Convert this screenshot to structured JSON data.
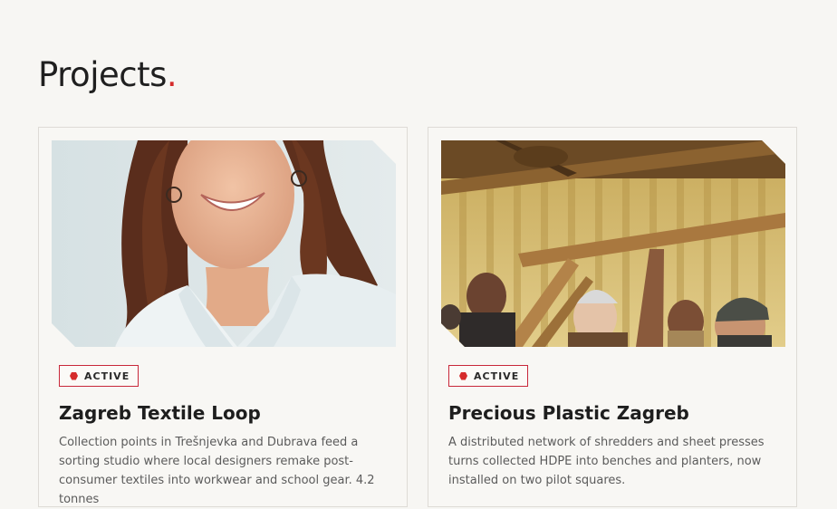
{
  "page": {
    "title": "Projects",
    "title_dot": ".",
    "accent_color": "#d52b2b"
  },
  "projects": [
    {
      "image": "portrait-of-smiling-woman",
      "status": "ACTIVE",
      "status_icon": "hexagon-icon",
      "title": "Zagreb Textile Loop",
      "description": "Collection points in Trešnjevka and Dubrava feed a sorting studio where local designers remake post-consumer textiles into workwear and school gear. 4.2 tonnes"
    },
    {
      "image": "people-lifting-wooden-beam-in-workshop",
      "status": "ACTIVE",
      "status_icon": "hexagon-icon",
      "title": "Precious Plastic Zagreb",
      "description": "A distributed network of shredders and sheet presses turns collected HDPE into benches and planters, now installed on two pilot squares."
    }
  ]
}
